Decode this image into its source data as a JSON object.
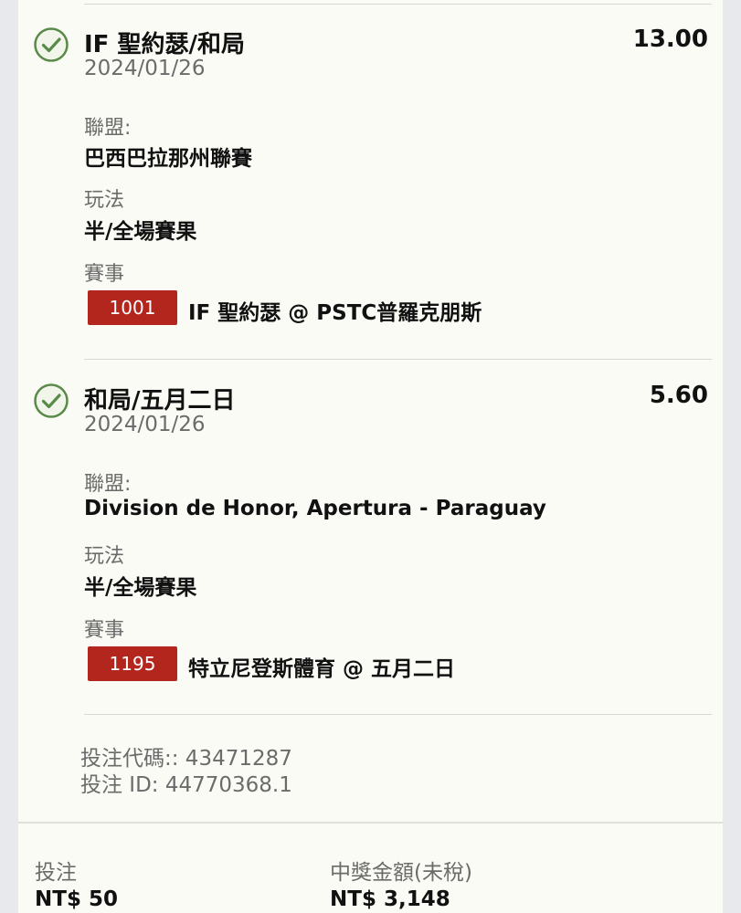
{
  "legs": [
    {
      "selection": "IF 聖約瑟/和局",
      "odds": "13.00",
      "date": "2024/01/26",
      "league_label": "聯盟:",
      "league": "巴西巴拉那州聯賽",
      "market_label": "玩法",
      "market": "半/全場賽果",
      "event_label": "賽事",
      "event_code": "1001",
      "event": "IF 聖約瑟 @ PSTC普羅克朋斯",
      "status_icon": "check-circle-icon"
    },
    {
      "selection": "和局/五月二日",
      "odds": "5.60",
      "date": "2024/01/26",
      "league_label": "聯盟:",
      "league": "Division de Honor, Apertura - Paraguay",
      "market_label": "玩法",
      "market": "半/全場賽果",
      "event_label": "賽事",
      "event_code": "1195",
      "event": "特立尼登斯體育 @ 五月二日",
      "status_icon": "check-circle-icon"
    }
  ],
  "bet_codes": {
    "code_line": "投注代碼:: 43471287",
    "id_line": "投注 ID: 44770368.1"
  },
  "summary": {
    "stake_label": "投注",
    "stake_value": "NT$ 50",
    "payout_label": "中獎金額(未稅)",
    "payout_value": "NT$ 3,148"
  },
  "colors": {
    "check_green": "#5a8a4a",
    "badge_red": "#b3261e",
    "card_bg": "#fbfbf5",
    "page_bg": "#e8e9ec"
  }
}
